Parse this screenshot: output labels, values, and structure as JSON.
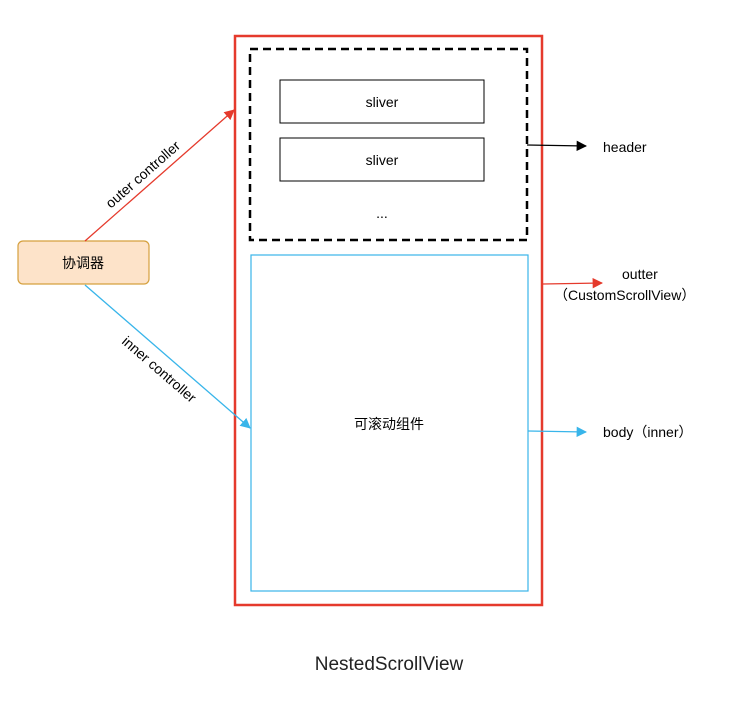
{
  "colors": {
    "outer_border": "#e53a2c",
    "inner_border": "#38b5ea",
    "coordinator_fill": "#fde3c9",
    "coordinator_border": "#d5a03e",
    "black": "#000000"
  },
  "header": {
    "slivers": [
      "sliver",
      "sliver"
    ],
    "ellipsis": "...",
    "label": "header"
  },
  "coordinator": {
    "label": "协调器"
  },
  "controllers": {
    "outer": "outer controller",
    "inner": "inner controller"
  },
  "outer_view": {
    "label_line1": "outter",
    "label_line2": "（CustomScrollView）"
  },
  "body": {
    "center_label": "可滚动组件",
    "label": "body（inner）"
  },
  "caption": "NestedScrollView"
}
